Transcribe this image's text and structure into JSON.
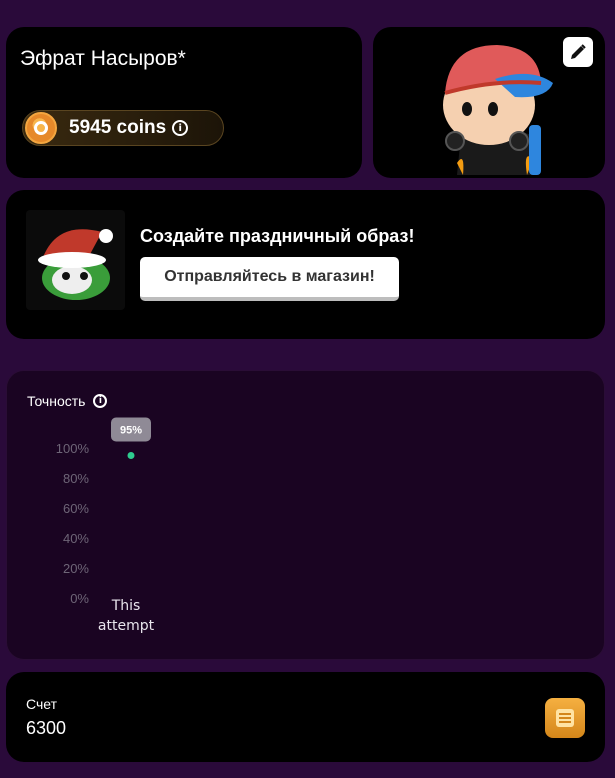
{
  "profile": {
    "player_name": "Эфрат Насыров*",
    "coins_text": "5945 coins",
    "info_glyph": "i"
  },
  "avatar": {
    "edit_icon": "pencil-icon"
  },
  "promo": {
    "title": "Создайте праздничный образ!",
    "button_label": "Отправляйтесь в магазин!"
  },
  "accuracy": {
    "label": "Точность",
    "info_glyph": "i"
  },
  "chart_data": {
    "type": "scatter",
    "title": "",
    "xlabel": "",
    "ylabel": "",
    "categories": [
      "This attempt"
    ],
    "category_lines": [
      [
        "This",
        "attempt"
      ]
    ],
    "values": [
      95
    ],
    "data_labels": [
      "95%"
    ],
    "ylim": [
      0,
      100
    ],
    "yticks": [
      "0%",
      "20%",
      "40%",
      "60%",
      "80%",
      "100%"
    ],
    "ytick_values": [
      0,
      20,
      40,
      60,
      80,
      100
    ],
    "grid": false,
    "point_color": "#2ecc8f"
  },
  "score": {
    "label": "Счет",
    "value": "6300"
  },
  "colors": {
    "background": "#2a0a3a",
    "card": "#000000",
    "chart_card": "#1a0422",
    "coin_gold": "#f3a640",
    "tick_text": "#6e6577",
    "tooltip_bg": "#8f8a96"
  }
}
